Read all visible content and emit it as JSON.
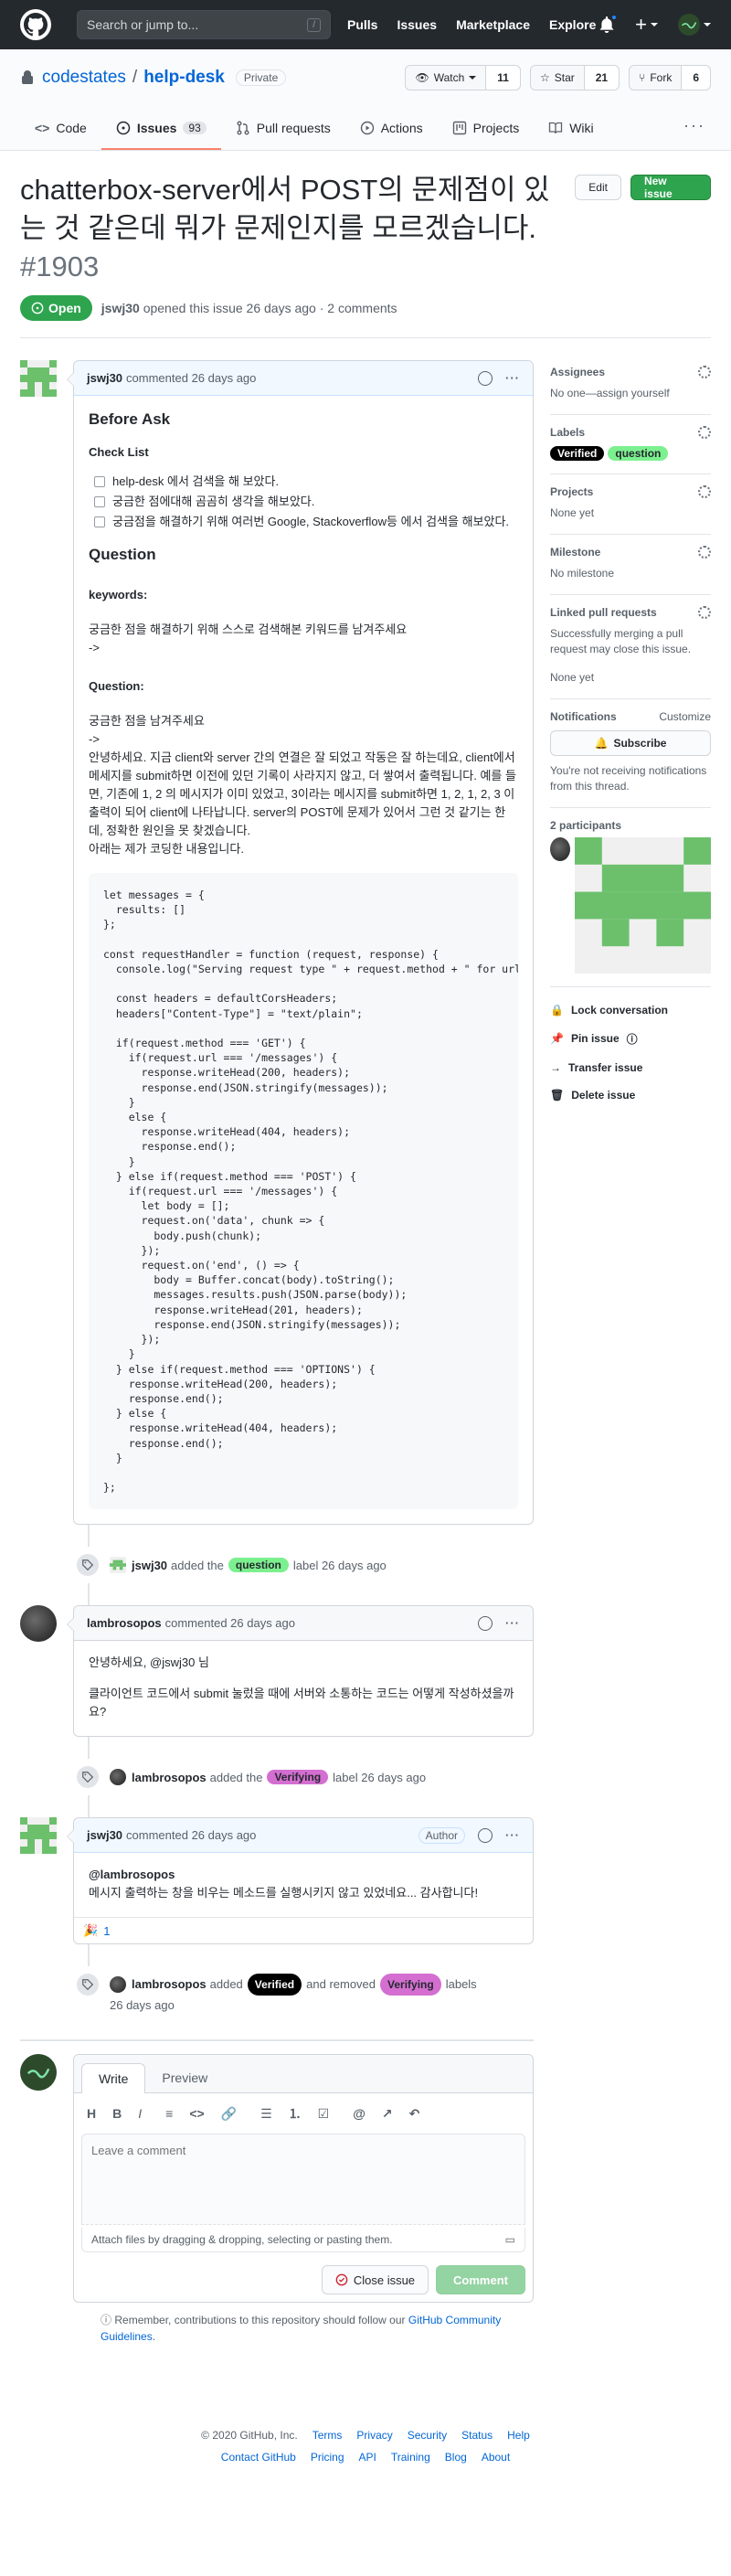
{
  "header": {
    "search_placeholder": "Search or jump to...",
    "search_key": "/",
    "nav": [
      "Pulls",
      "Issues",
      "Marketplace",
      "Explore"
    ],
    "plus_label": "+"
  },
  "repo": {
    "owner": "codestates",
    "name": "help-desk",
    "visibility": "Private",
    "watch_label": "Watch",
    "watch_count": "11",
    "star_label": "Star",
    "star_count": "21",
    "fork_label": "Fork",
    "fork_count": "6",
    "tabs": [
      {
        "label": "Code",
        "icon": "code-icon"
      },
      {
        "label": "Issues",
        "counter": "93",
        "icon": "issue-icon"
      },
      {
        "label": "Pull requests",
        "icon": "pull-request-icon"
      },
      {
        "label": "Actions",
        "icon": "play-icon"
      },
      {
        "label": "Projects",
        "icon": "project-icon"
      },
      {
        "label": "Wiki",
        "icon": "book-icon"
      }
    ]
  },
  "issue": {
    "title": "chatterbox-server에서 POST의 문제점이 있는 것 같은데 뭐가 문제인지를 모르겠습니다.",
    "number": "#1903",
    "edit_label": "Edit",
    "new_issue_label": "New issue",
    "state": "Open",
    "author": "jswj30",
    "opened_text": "opened this issue 26 days ago · 2 comments"
  },
  "first_comment": {
    "author": "jswj30",
    "time": "commented 26 days ago",
    "heading": "Before Ask",
    "checklist_title": "Check List",
    "checklist": [
      "help-desk 에서 검색을 해 보았다.",
      "궁금한 점에대해 곰곰히 생각을 해보았다.",
      "궁금점을 해결하기 위해 여러번 Google, Stackoverflow등 에서 검색을 해보았다."
    ],
    "question_heading": "Question",
    "keywords_label": "keywords:",
    "keywords_text": "궁금한 점을 해결하기 위해 스스로 검색해본 키워드를 남겨주세요",
    "keywords_arrow": "->",
    "question_label": "Question:",
    "question_hint": "궁금한 점을 남겨주세요",
    "question_arrow": "->",
    "question_text": "안녕하세요. 지금 client와 server 간의 연결은 잘 되었고 작동은 잘 하는데요, client에서 메세지를 submit하면 이전에 있던 기록이 사라지지 않고, 더 쌓여서 출력됩니다. 예를 들면, 기존에 1, 2 의 메시지가 이미 있었고, 3이라는 메시지를 submit하면 1, 2, 1, 2, 3 이 출력이 되어 client에 나타납니다. server의 POST에 문제가 있어서 그런 것 같기는 한데, 정확한 원인을 못 찾겠습니다.",
    "question_tail": "아래는 제가 코딩한 내용입니다.",
    "code": "let messages = {\n  results: []\n};\n\nconst requestHandler = function (request, response) {\n  console.log(\"Serving request type \" + request.method + \" for url \" + request.url);\n\n  const headers = defaultCorsHeaders;\n  headers[\"Content-Type\"] = \"text/plain\";\n\n  if(request.method === 'GET') {\n    if(request.url === '/messages') {\n      response.writeHead(200, headers);\n      response.end(JSON.stringify(messages));\n    }\n    else {\n      response.writeHead(404, headers);\n      response.end();\n    }\n  } else if(request.method === 'POST') {\n    if(request.url === '/messages') {\n      let body = [];\n      request.on('data', chunk => {\n        body.push(chunk);\n      });\n      request.on('end', () => {\n        body = Buffer.concat(body).toString();\n        messages.results.push(JSON.parse(body));\n        response.writeHead(201, headers);\n        response.end(JSON.stringify(messages));\n      });\n    }\n  } else if(request.method === 'OPTIONS') {\n    response.writeHead(200, headers);\n    response.end();\n  } else {\n    response.writeHead(404, headers);\n    response.end();\n  }\n\n};"
  },
  "event1": {
    "actor": "jswj30",
    "pre": "added the",
    "label": "question",
    "post": "label 26 days ago"
  },
  "second_comment": {
    "author": "lambrosopos",
    "time": "commented 26 days ago",
    "greeting": "안녕하세요, @jswj30 님",
    "body": "클라이언트 코드에서 submit 눌렀을 때에 서버와 소통하는 코드는 어떻게 작성하셨을까요?"
  },
  "event2": {
    "actor": "lambrosopos",
    "pre": "added the",
    "label": "Verifying",
    "post": "label 26 days ago"
  },
  "third_comment": {
    "author": "jswj30",
    "time": "commented 26 days ago",
    "badge": "Author",
    "mention": "@lambrosopos",
    "body": "메시지 출력하는 창을 비우는 메소드를 실행시키지 않고 있었네요... 감사합니다!",
    "reaction_emoji": "🎉",
    "reaction_count": "1"
  },
  "event3": {
    "actor": "lambrosopos",
    "pre": "added",
    "label_a": "Verified",
    "mid": "and removed",
    "label_b": "Verifying",
    "post": "labels",
    "time": "26 days ago"
  },
  "new_comment": {
    "write_tab": "Write",
    "preview_tab": "Preview",
    "placeholder": "Leave a comment",
    "attach_text": "Attach files by dragging & dropping, selecting or pasting them.",
    "close_label": "Close issue",
    "comment_label": "Comment",
    "remember_text": "Remember, contributions to this repository should follow our",
    "guidelines_link": "GitHub Community Guidelines",
    "remember_end": "."
  },
  "sidebar": {
    "assignees_title": "Assignees",
    "assignees_text": "No one—assign yourself",
    "labels_title": "Labels",
    "labels": [
      {
        "name": "Verified",
        "bg": "#000000",
        "fg": "#ffffff"
      },
      {
        "name": "question",
        "bg": "#7cf08f",
        "fg": "#24292e"
      }
    ],
    "projects_title": "Projects",
    "projects_text": "None yet",
    "milestone_title": "Milestone",
    "milestone_text": "No milestone",
    "linked_title": "Linked pull requests",
    "linked_text": "Successfully merging a pull request may close this issue.",
    "linked_none": "None yet",
    "notifications_title": "Notifications",
    "customize": "Customize",
    "subscribe_label": "Subscribe",
    "notif_text": "You're not receiving notifications from this thread.",
    "participants_title": "2 participants",
    "actions": [
      "Lock conversation",
      "Pin issue",
      "Transfer issue",
      "Delete issue"
    ]
  },
  "footer": {
    "copyright": "© 2020 GitHub, Inc.",
    "row1": [
      "Terms",
      "Privacy",
      "Security",
      "Status",
      "Help"
    ],
    "row2": [
      "Contact GitHub",
      "Pricing",
      "API",
      "Training",
      "Blog",
      "About"
    ]
  },
  "colors": {
    "accent": "#0366d6",
    "open_green": "#2ea44f",
    "question_label": "#7cf08f",
    "verifying_label": "#d46ed1",
    "verified_label": "#000000"
  }
}
